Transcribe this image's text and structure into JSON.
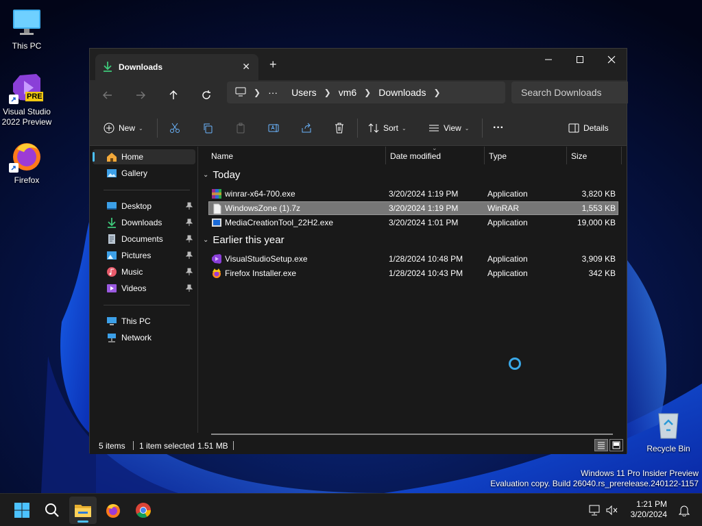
{
  "desktop": {
    "icons": [
      {
        "label": "This PC",
        "icon": "monitor-icon"
      },
      {
        "label": "Visual Studio\n2022 Preview",
        "icon": "visual-studio-icon",
        "badge": "PRE"
      },
      {
        "label": "Firefox",
        "icon": "firefox-icon"
      },
      {
        "label": "Recycle Bin",
        "icon": "recycle-bin-icon"
      }
    ],
    "watermark_line1": "Windows 11 Pro Insider Preview",
    "watermark_line2": "Evaluation copy. Build 26040.rs_prerelease.240122-1157"
  },
  "window": {
    "tab_title": "Downloads",
    "address": {
      "more": "···",
      "crumbs": [
        "Users",
        "vm6",
        "Downloads"
      ]
    },
    "search_placeholder": "Search Downloads",
    "toolbar": {
      "new": "New",
      "sort": "Sort",
      "view": "View",
      "more": "···",
      "details": "Details"
    },
    "sidebar": {
      "items": [
        {
          "label": "Home",
          "icon": "home-icon"
        },
        {
          "label": "Gallery",
          "icon": "gallery-icon"
        },
        {
          "label": "Desktop",
          "icon": "desktop-icon"
        },
        {
          "label": "Downloads",
          "icon": "downloads-icon"
        },
        {
          "label": "Documents",
          "icon": "documents-icon"
        },
        {
          "label": "Pictures",
          "icon": "pictures-icon"
        },
        {
          "label": "Music",
          "icon": "music-icon"
        },
        {
          "label": "Videos",
          "icon": "videos-icon"
        },
        {
          "label": "This PC",
          "icon": "this-pc-icon"
        },
        {
          "label": "Network",
          "icon": "network-icon"
        }
      ]
    },
    "columns": [
      "Name",
      "Date modified",
      "Type",
      "Size"
    ],
    "groups": [
      {
        "label": "Today",
        "files": [
          {
            "name": "winrar-x64-700.exe",
            "date": "3/20/2024 1:19 PM",
            "type": "Application",
            "size": "3,820 KB",
            "icon": "winrar-icon"
          },
          {
            "name": "WindowsZone (1).7z",
            "date": "3/20/2024 1:19 PM",
            "type": "WinRAR",
            "size": "1,553 KB",
            "icon": "archive-file-icon",
            "selected": true
          },
          {
            "name": "MediaCreationTool_22H2.exe",
            "date": "3/20/2024 1:01 PM",
            "type": "Application",
            "size": "19,000 KB",
            "icon": "media-creation-icon"
          }
        ]
      },
      {
        "label": "Earlier this year",
        "files": [
          {
            "name": "VisualStudioSetup.exe",
            "date": "1/28/2024 10:48 PM",
            "type": "Application",
            "size": "3,909 KB",
            "icon": "visual-studio-setup-icon"
          },
          {
            "name": "Firefox Installer.exe",
            "date": "1/28/2024 10:43 PM",
            "type": "Application",
            "size": "342 KB",
            "icon": "firefox-installer-icon"
          }
        ]
      }
    ],
    "status": {
      "count": "5 items",
      "selection": "1 item selected",
      "size": "1.51 MB"
    }
  },
  "taskbar": {
    "apps": [
      "start-icon",
      "search-icon",
      "file-explorer-icon",
      "firefox-icon",
      "chrome-icon"
    ],
    "time": "1:21 PM",
    "date": "3/20/2024"
  },
  "colors": {
    "accent": "#4cc2ff",
    "window_bg": "#191919",
    "selected_row": "#777777"
  }
}
